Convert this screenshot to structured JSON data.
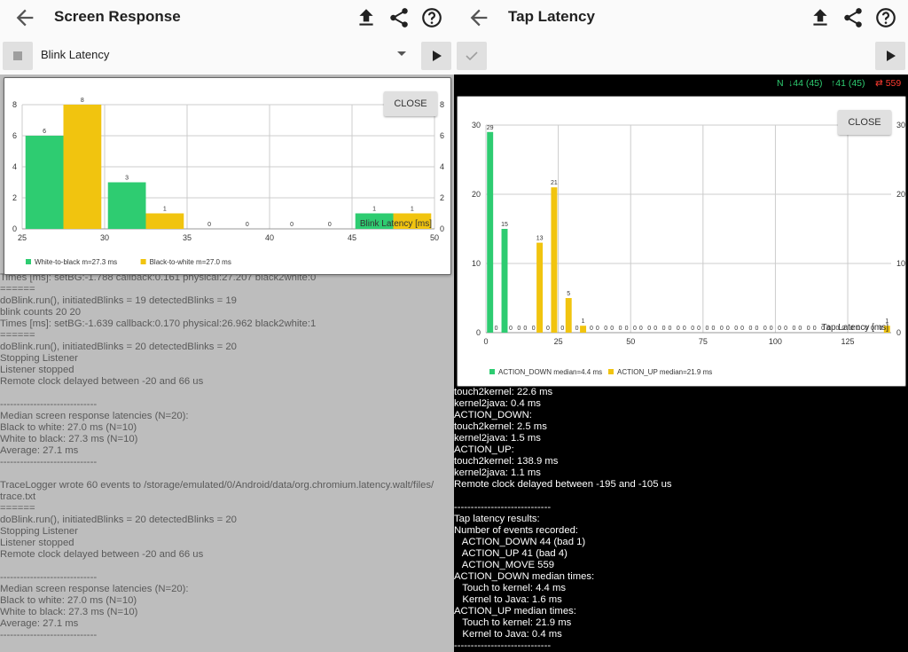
{
  "left": {
    "title": "Screen Response",
    "spinner_value": "Blink Latency",
    "close_label": "CLOSE",
    "log_lines": [
      "Times [ms]: setBG:-1.788 callback:0.161 physical:27.207 black2white:0",
      "======",
      "doBlink.run(), initiatedBlinks = 19 detectedBlinks = 19",
      "blink counts 20 20",
      "Times [ms]: setBG:-1.639 callback:0.170 physical:26.962 black2white:1",
      "======",
      "doBlink.run(), initiatedBlinks = 20 detectedBlinks = 20",
      "Stopping Listener",
      "Listener stopped",
      "Remote clock delayed between -20 and 66 us",
      "",
      "-----------------------------",
      "Median screen response latencies (N=20):",
      "Black to white: 27.0 ms (N=10)",
      "White to black: 27.3 ms (N=10)",
      "Average: 27.1 ms",
      "-----------------------------",
      "",
      "TraceLogger wrote 60 events to /storage/emulated/0/Android/data/org.chromium.latency.walt/files/",
      "trace.txt",
      "======",
      "doBlink.run(), initiatedBlinks = 20 detectedBlinks = 20",
      "Stopping Listener",
      "Listener stopped",
      "Remote clock delayed between -20 and 66 us",
      "",
      "-----------------------------",
      "Median screen response latencies (N=20):",
      "Black to white: 27.0 ms (N=10)",
      "White to black: 27.3 ms (N=10)",
      "Average: 27.1 ms",
      "-----------------------------"
    ]
  },
  "right": {
    "title": "Tap Latency",
    "close_label": "CLOSE",
    "status": {
      "n": "N",
      "down": "↓44 (45)",
      "up": "↑41 (45)",
      "move": "⇄ 559"
    },
    "log_lines": [
      "touch2kernel: 22.6 ms",
      "kernel2java: 0.4 ms",
      "ACTION_DOWN:",
      "touch2kernel: 2.5 ms",
      "kernel2java: 1.5 ms",
      "ACTION_UP:",
      "touch2kernel: 138.9 ms",
      "kernel2java: 1.1 ms",
      "Remote clock delayed between -195 and -105 us",
      "",
      "-----------------------------",
      "Tap latency results:",
      "Number of events recorded:",
      "   ACTION_DOWN 44 (bad 1)",
      "   ACTION_UP 41 (bad 4)",
      "   ACTION_MOVE 559",
      "ACTION_DOWN median times:",
      "   Touch to kernel: 4.4 ms",
      "   Kernel to Java: 1.6 ms",
      "ACTION_UP median times:",
      "   Touch to kernel: 21.9 ms",
      "   Kernel to Java: 0.4 ms",
      "-----------------------------"
    ]
  },
  "colors": {
    "green": "#2ecc71",
    "yellow": "#f1c40f",
    "status_green": "#2ecc71",
    "status_red": "#ff3b30"
  },
  "chart_data": [
    {
      "type": "bar",
      "xlabel": "Blink Latency [ms]",
      "x_ticks": [
        "25",
        "30",
        "35",
        "40",
        "45",
        "50"
      ],
      "y_ticks": [
        "0",
        "2",
        "4",
        "6",
        "8"
      ],
      "xlim": [
        25,
        50
      ],
      "ylim": [
        0,
        8
      ],
      "bin_starts": [
        25,
        30,
        35,
        40,
        45
      ],
      "bin_width": 5,
      "series": [
        {
          "name": "White-to-black m=27.3 ms",
          "color": "#2ecc71",
          "values": [
            6,
            3,
            0,
            0,
            1
          ]
        },
        {
          "name": "Black-to-white m=27.0 ms",
          "color": "#f1c40f",
          "values": [
            8,
            1,
            0,
            0,
            1
          ]
        }
      ],
      "grid": true,
      "legend": "bottom-left"
    },
    {
      "type": "bar",
      "xlabel": "Tap Latency [ms]",
      "x_ticks": [
        "0",
        "25",
        "50",
        "75",
        "100",
        "125"
      ],
      "y_ticks": [
        "0",
        "10",
        "20",
        "30"
      ],
      "xlim": [
        0,
        140
      ],
      "ylim": [
        0,
        30
      ],
      "bin_starts": [
        0,
        5,
        10,
        15,
        20,
        25,
        30,
        35,
        40,
        45,
        50,
        55,
        60,
        65,
        70,
        75,
        80,
        85,
        90,
        95,
        100,
        105,
        110,
        115,
        120,
        125,
        130,
        135
      ],
      "bin_width": 5,
      "series": [
        {
          "name": "ACTION_DOWN median=4.4 ms",
          "color": "#2ecc71",
          "values": [
            29,
            15,
            0,
            0,
            0,
            0,
            0,
            0,
            0,
            0,
            0,
            0,
            0,
            0,
            0,
            0,
            0,
            0,
            0,
            0,
            0,
            0,
            0,
            0,
            0,
            0,
            0,
            0
          ]
        },
        {
          "name": "ACTION_UP median=21.9 ms",
          "color": "#f1c40f",
          "values": [
            0,
            0,
            0,
            13,
            21,
            5,
            1,
            0,
            0,
            0,
            0,
            0,
            0,
            0,
            0,
            0,
            0,
            0,
            0,
            0,
            0,
            0,
            0,
            0,
            0,
            0,
            0,
            1
          ]
        }
      ],
      "grid": true,
      "legend": "bottom-left"
    }
  ]
}
